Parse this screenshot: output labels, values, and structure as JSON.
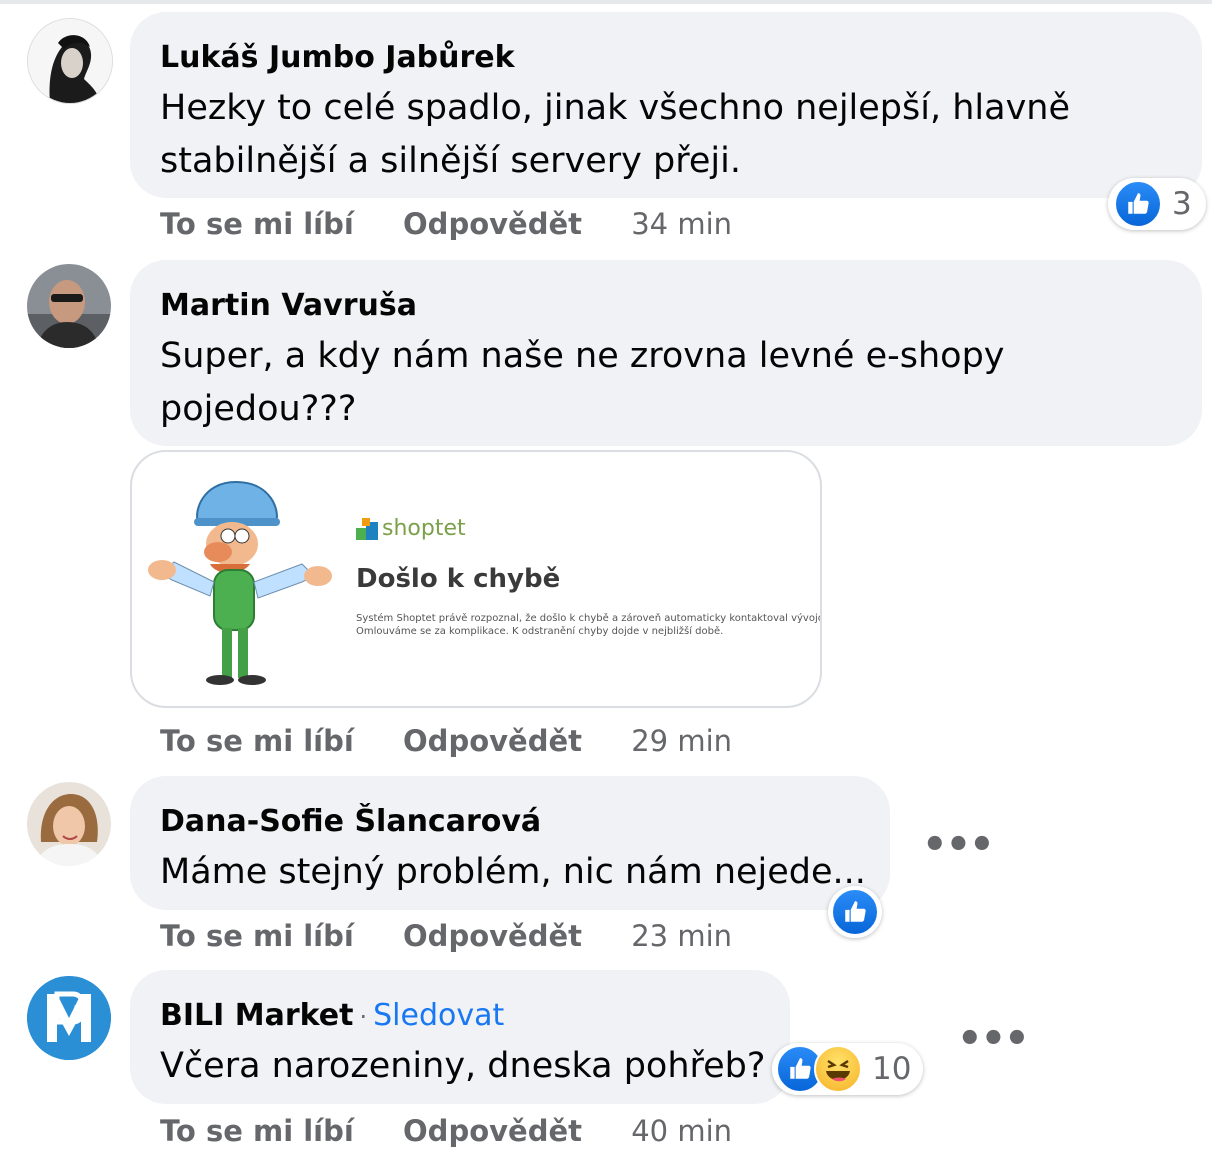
{
  "comments": [
    {
      "author": "Lukáš Jumbo Jabůrek",
      "lines": [
        "Hezky to celé spadlo, jinak všechno nejlepší, hlavně",
        "stabilnější a silnější servery přeji."
      ],
      "like_label": "To se mi líbí",
      "reply_label": "Odpovědět",
      "time": "34 min",
      "reaction_count": "3"
    },
    {
      "author": "Martin Vavruša",
      "lines": [
        "Super, a kdy nám naše ne zrovna levné e-shopy",
        "pojedou???"
      ],
      "like_label": "To se mi líbí",
      "reply_label": "Odpovědět",
      "time": "29 min",
      "attachment": {
        "brand": "shoptet",
        "title": "Došlo k chybě",
        "desc_line1": "Systém Shoptet právě rozpoznal, že došlo k chybě a zároveň automaticky kontaktoval vývojový tým.",
        "desc_line2": "Omlouváme se za komplikace. K odstranění chyby dojde v nejbližší době."
      }
    },
    {
      "author": "Dana-Sofie Šlancarová",
      "lines": [
        "Máme stejný problém, nic nám nejede..."
      ],
      "like_label": "To se mi líbí",
      "reply_label": "Odpovědět",
      "time": "23 min",
      "more": "•••"
    },
    {
      "author": "BILI Market",
      "separator": "·",
      "follow_label": "Sledovat",
      "lines": [
        "Včera narozeniny, dneska pohřeb?"
      ],
      "like_label": "To se mi líbí",
      "reply_label": "Odpovědět",
      "time": "40 min",
      "reaction_count": "10",
      "more": "•••"
    }
  ],
  "colors": {
    "bubble": "#f0f2f5",
    "link": "#1877f2",
    "muted": "#65676b",
    "like": "#1877f2"
  },
  "icons": [
    "like-icon",
    "haha-icon",
    "more-icon"
  ]
}
